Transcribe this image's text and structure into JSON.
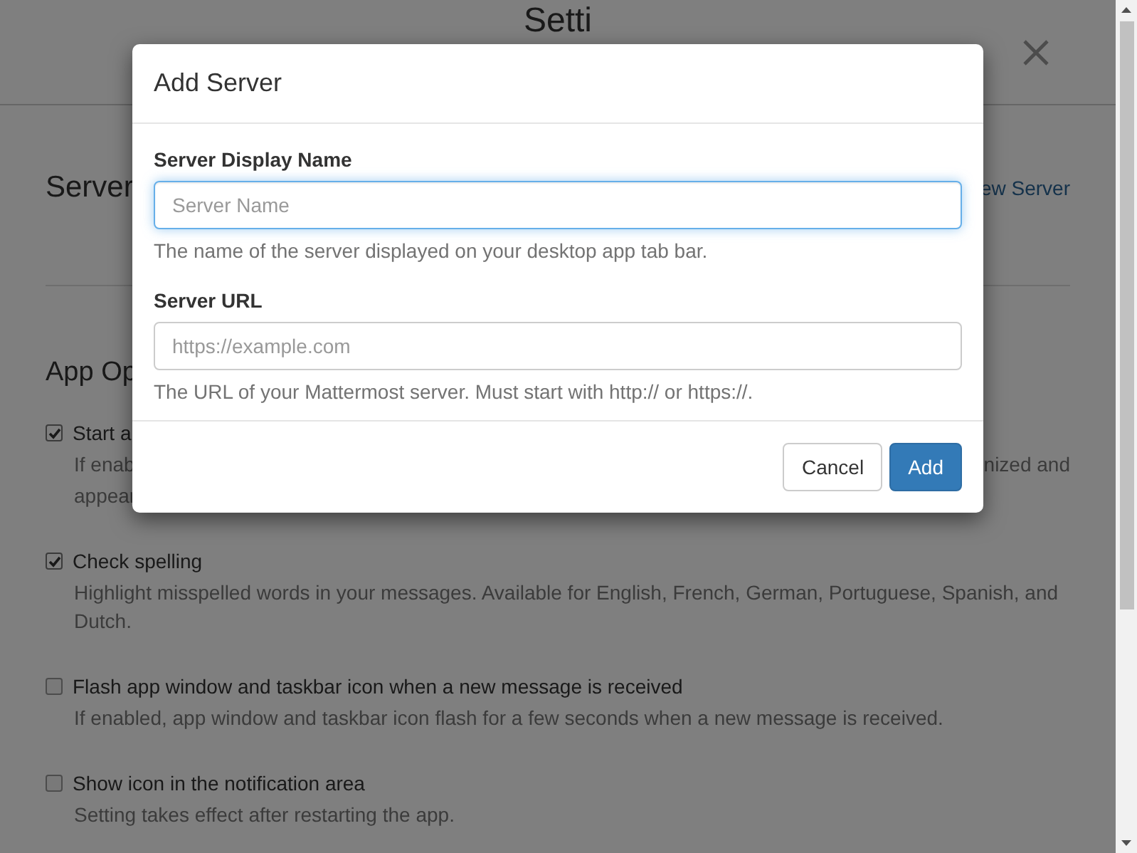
{
  "page": {
    "title": "Setti",
    "server_section": {
      "heading": "Server",
      "link": "ew Server"
    },
    "options_section": {
      "heading": "App Op",
      "options": [
        {
          "label": "Start a",
          "checked": true,
          "description_lines": [
            [
              "If enab",
              "nized and"
            ],
            [
              "appear"
            ]
          ]
        },
        {
          "label": "Check spelling",
          "checked": true,
          "description_lines": [
            [
              "Highlight misspelled words in your messages. Available for English, French, German, Portuguese, Spanish, and Dutch."
            ]
          ]
        },
        {
          "label": "Flash app window and taskbar icon when a new message is received",
          "checked": false,
          "description_lines": [
            [
              "If enabled, app window and taskbar icon flash for a few seconds when a new message is received."
            ]
          ]
        },
        {
          "label": "Show icon in the notification area",
          "checked": false,
          "description_lines": [
            [
              "Setting takes effect after restarting the app."
            ]
          ]
        }
      ]
    }
  },
  "dialog": {
    "title": "Add Server",
    "fields": [
      {
        "label": "Server Display Name",
        "placeholder": "Server Name",
        "help": "The name of the server displayed on your desktop app tab bar.",
        "focused": true
      },
      {
        "label": "Server URL",
        "placeholder": "https://example.com",
        "help": "The URL of your Mattermost server. Must start with http:// or https://.",
        "focused": false
      }
    ],
    "buttons": [
      {
        "label": "Cancel",
        "kind": "default"
      },
      {
        "label": "Add",
        "kind": "primary"
      }
    ]
  }
}
